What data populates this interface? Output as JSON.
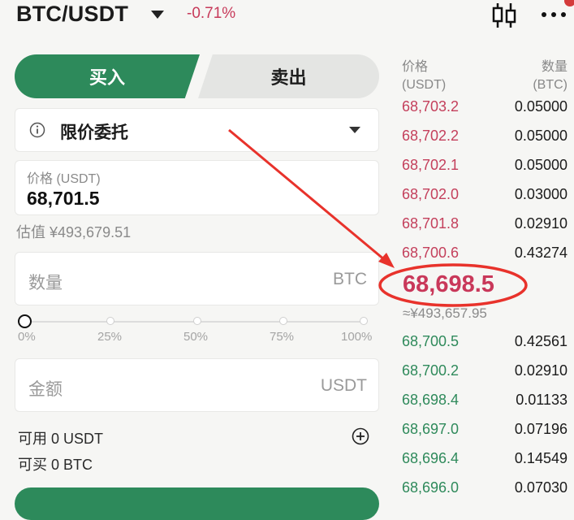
{
  "header": {
    "pair": "BTC/USDT",
    "change": "-0.71%",
    "icons": [
      "candlestick-chart-icon",
      "more-icon"
    ]
  },
  "tabs": {
    "buy": "买入",
    "sell": "卖出"
  },
  "order_type": {
    "label": "限价委托"
  },
  "price": {
    "label": "价格 (USDT)",
    "value": "68,701.5"
  },
  "estimate": "估值 ¥493,679.51",
  "quantity": {
    "placeholder": "数量",
    "unit": "BTC"
  },
  "slider": {
    "value": 0,
    "marks": [
      "0%",
      "25%",
      "50%",
      "75%",
      "100%"
    ]
  },
  "amount": {
    "placeholder": "金额",
    "unit": "USDT"
  },
  "available": "可用 0 USDT",
  "can_buy": "可买 0 BTC",
  "orderbook": {
    "price_header": [
      "价格",
      "(USDT)"
    ],
    "qty_header": [
      "数量",
      "(BTC)"
    ],
    "asks": [
      {
        "price": "68,703.2",
        "qty": "0.05000"
      },
      {
        "price": "68,702.2",
        "qty": "0.05000"
      },
      {
        "price": "68,702.1",
        "qty": "0.05000"
      },
      {
        "price": "68,702.0",
        "qty": "0.03000"
      },
      {
        "price": "68,701.8",
        "qty": "0.02910"
      },
      {
        "price": "68,700.6",
        "qty": "0.43274"
      }
    ],
    "last_price": "68,698.5",
    "last_price_fiat": "≈¥493,657.95",
    "bids": [
      {
        "price": "68,700.5",
        "qty": "0.42561"
      },
      {
        "price": "68,700.2",
        "qty": "0.02910"
      },
      {
        "price": "68,698.4",
        "qty": "0.01133"
      },
      {
        "price": "68,697.0",
        "qty": "0.07196"
      },
      {
        "price": "68,696.4",
        "qty": "0.14549"
      },
      {
        "price": "68,696.0",
        "qty": "0.07030"
      }
    ]
  },
  "colors": {
    "buy_green": "#2d8a5b",
    "ask_red": "#c4405c",
    "annotation_red": "#e8322b"
  }
}
